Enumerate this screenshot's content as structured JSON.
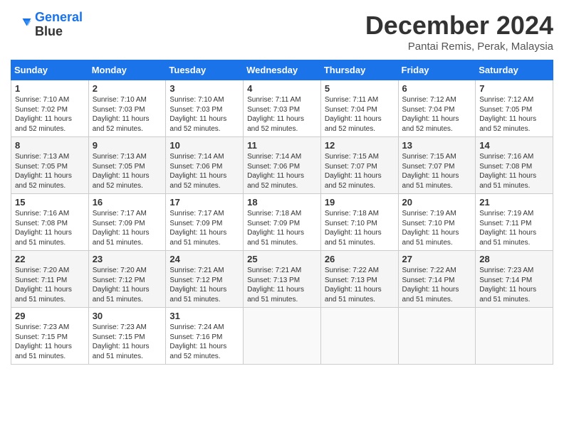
{
  "logo": {
    "line1": "General",
    "line2": "Blue"
  },
  "title": "December 2024",
  "location": "Pantai Remis, Perak, Malaysia",
  "days_of_week": [
    "Sunday",
    "Monday",
    "Tuesday",
    "Wednesday",
    "Thursday",
    "Friday",
    "Saturday"
  ],
  "weeks": [
    [
      {
        "day": "1",
        "sunrise": "7:10 AM",
        "sunset": "7:02 PM",
        "daylight": "11 hours and 52 minutes"
      },
      {
        "day": "2",
        "sunrise": "7:10 AM",
        "sunset": "7:03 PM",
        "daylight": "11 hours and 52 minutes"
      },
      {
        "day": "3",
        "sunrise": "7:10 AM",
        "sunset": "7:03 PM",
        "daylight": "11 hours and 52 minutes"
      },
      {
        "day": "4",
        "sunrise": "7:11 AM",
        "sunset": "7:03 PM",
        "daylight": "11 hours and 52 minutes"
      },
      {
        "day": "5",
        "sunrise": "7:11 AM",
        "sunset": "7:04 PM",
        "daylight": "11 hours and 52 minutes"
      },
      {
        "day": "6",
        "sunrise": "7:12 AM",
        "sunset": "7:04 PM",
        "daylight": "11 hours and 52 minutes"
      },
      {
        "day": "7",
        "sunrise": "7:12 AM",
        "sunset": "7:05 PM",
        "daylight": "11 hours and 52 minutes"
      }
    ],
    [
      {
        "day": "8",
        "sunrise": "7:13 AM",
        "sunset": "7:05 PM",
        "daylight": "11 hours and 52 minutes"
      },
      {
        "day": "9",
        "sunrise": "7:13 AM",
        "sunset": "7:05 PM",
        "daylight": "11 hours and 52 minutes"
      },
      {
        "day": "10",
        "sunrise": "7:14 AM",
        "sunset": "7:06 PM",
        "daylight": "11 hours and 52 minutes"
      },
      {
        "day": "11",
        "sunrise": "7:14 AM",
        "sunset": "7:06 PM",
        "daylight": "11 hours and 52 minutes"
      },
      {
        "day": "12",
        "sunrise": "7:15 AM",
        "sunset": "7:07 PM",
        "daylight": "11 hours and 52 minutes"
      },
      {
        "day": "13",
        "sunrise": "7:15 AM",
        "sunset": "7:07 PM",
        "daylight": "11 hours and 51 minutes"
      },
      {
        "day": "14",
        "sunrise": "7:16 AM",
        "sunset": "7:08 PM",
        "daylight": "11 hours and 51 minutes"
      }
    ],
    [
      {
        "day": "15",
        "sunrise": "7:16 AM",
        "sunset": "7:08 PM",
        "daylight": "11 hours and 51 minutes"
      },
      {
        "day": "16",
        "sunrise": "7:17 AM",
        "sunset": "7:09 PM",
        "daylight": "11 hours and 51 minutes"
      },
      {
        "day": "17",
        "sunrise": "7:17 AM",
        "sunset": "7:09 PM",
        "daylight": "11 hours and 51 minutes"
      },
      {
        "day": "18",
        "sunrise": "7:18 AM",
        "sunset": "7:09 PM",
        "daylight": "11 hours and 51 minutes"
      },
      {
        "day": "19",
        "sunrise": "7:18 AM",
        "sunset": "7:10 PM",
        "daylight": "11 hours and 51 minutes"
      },
      {
        "day": "20",
        "sunrise": "7:19 AM",
        "sunset": "7:10 PM",
        "daylight": "11 hours and 51 minutes"
      },
      {
        "day": "21",
        "sunrise": "7:19 AM",
        "sunset": "7:11 PM",
        "daylight": "11 hours and 51 minutes"
      }
    ],
    [
      {
        "day": "22",
        "sunrise": "7:20 AM",
        "sunset": "7:11 PM",
        "daylight": "11 hours and 51 minutes"
      },
      {
        "day": "23",
        "sunrise": "7:20 AM",
        "sunset": "7:12 PM",
        "daylight": "11 hours and 51 minutes"
      },
      {
        "day": "24",
        "sunrise": "7:21 AM",
        "sunset": "7:12 PM",
        "daylight": "11 hours and 51 minutes"
      },
      {
        "day": "25",
        "sunrise": "7:21 AM",
        "sunset": "7:13 PM",
        "daylight": "11 hours and 51 minutes"
      },
      {
        "day": "26",
        "sunrise": "7:22 AM",
        "sunset": "7:13 PM",
        "daylight": "11 hours and 51 minutes"
      },
      {
        "day": "27",
        "sunrise": "7:22 AM",
        "sunset": "7:14 PM",
        "daylight": "11 hours and 51 minutes"
      },
      {
        "day": "28",
        "sunrise": "7:23 AM",
        "sunset": "7:14 PM",
        "daylight": "11 hours and 51 minutes"
      }
    ],
    [
      {
        "day": "29",
        "sunrise": "7:23 AM",
        "sunset": "7:15 PM",
        "daylight": "11 hours and 51 minutes"
      },
      {
        "day": "30",
        "sunrise": "7:23 AM",
        "sunset": "7:15 PM",
        "daylight": "11 hours and 51 minutes"
      },
      {
        "day": "31",
        "sunrise": "7:24 AM",
        "sunset": "7:16 PM",
        "daylight": "11 hours and 52 minutes"
      },
      null,
      null,
      null,
      null
    ]
  ]
}
